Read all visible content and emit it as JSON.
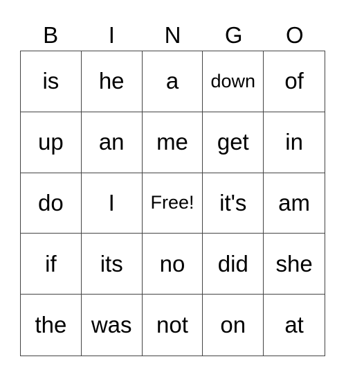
{
  "header": [
    "B",
    "I",
    "N",
    "G",
    "O"
  ],
  "cells": [
    [
      "is",
      "he",
      "a",
      "down",
      "of"
    ],
    [
      "up",
      "an",
      "me",
      "get",
      "in"
    ],
    [
      "do",
      "I",
      "Free!",
      "it's",
      "am"
    ],
    [
      "if",
      "its",
      "no",
      "did",
      "she"
    ],
    [
      "the",
      "was",
      "not",
      "on",
      "at"
    ]
  ]
}
